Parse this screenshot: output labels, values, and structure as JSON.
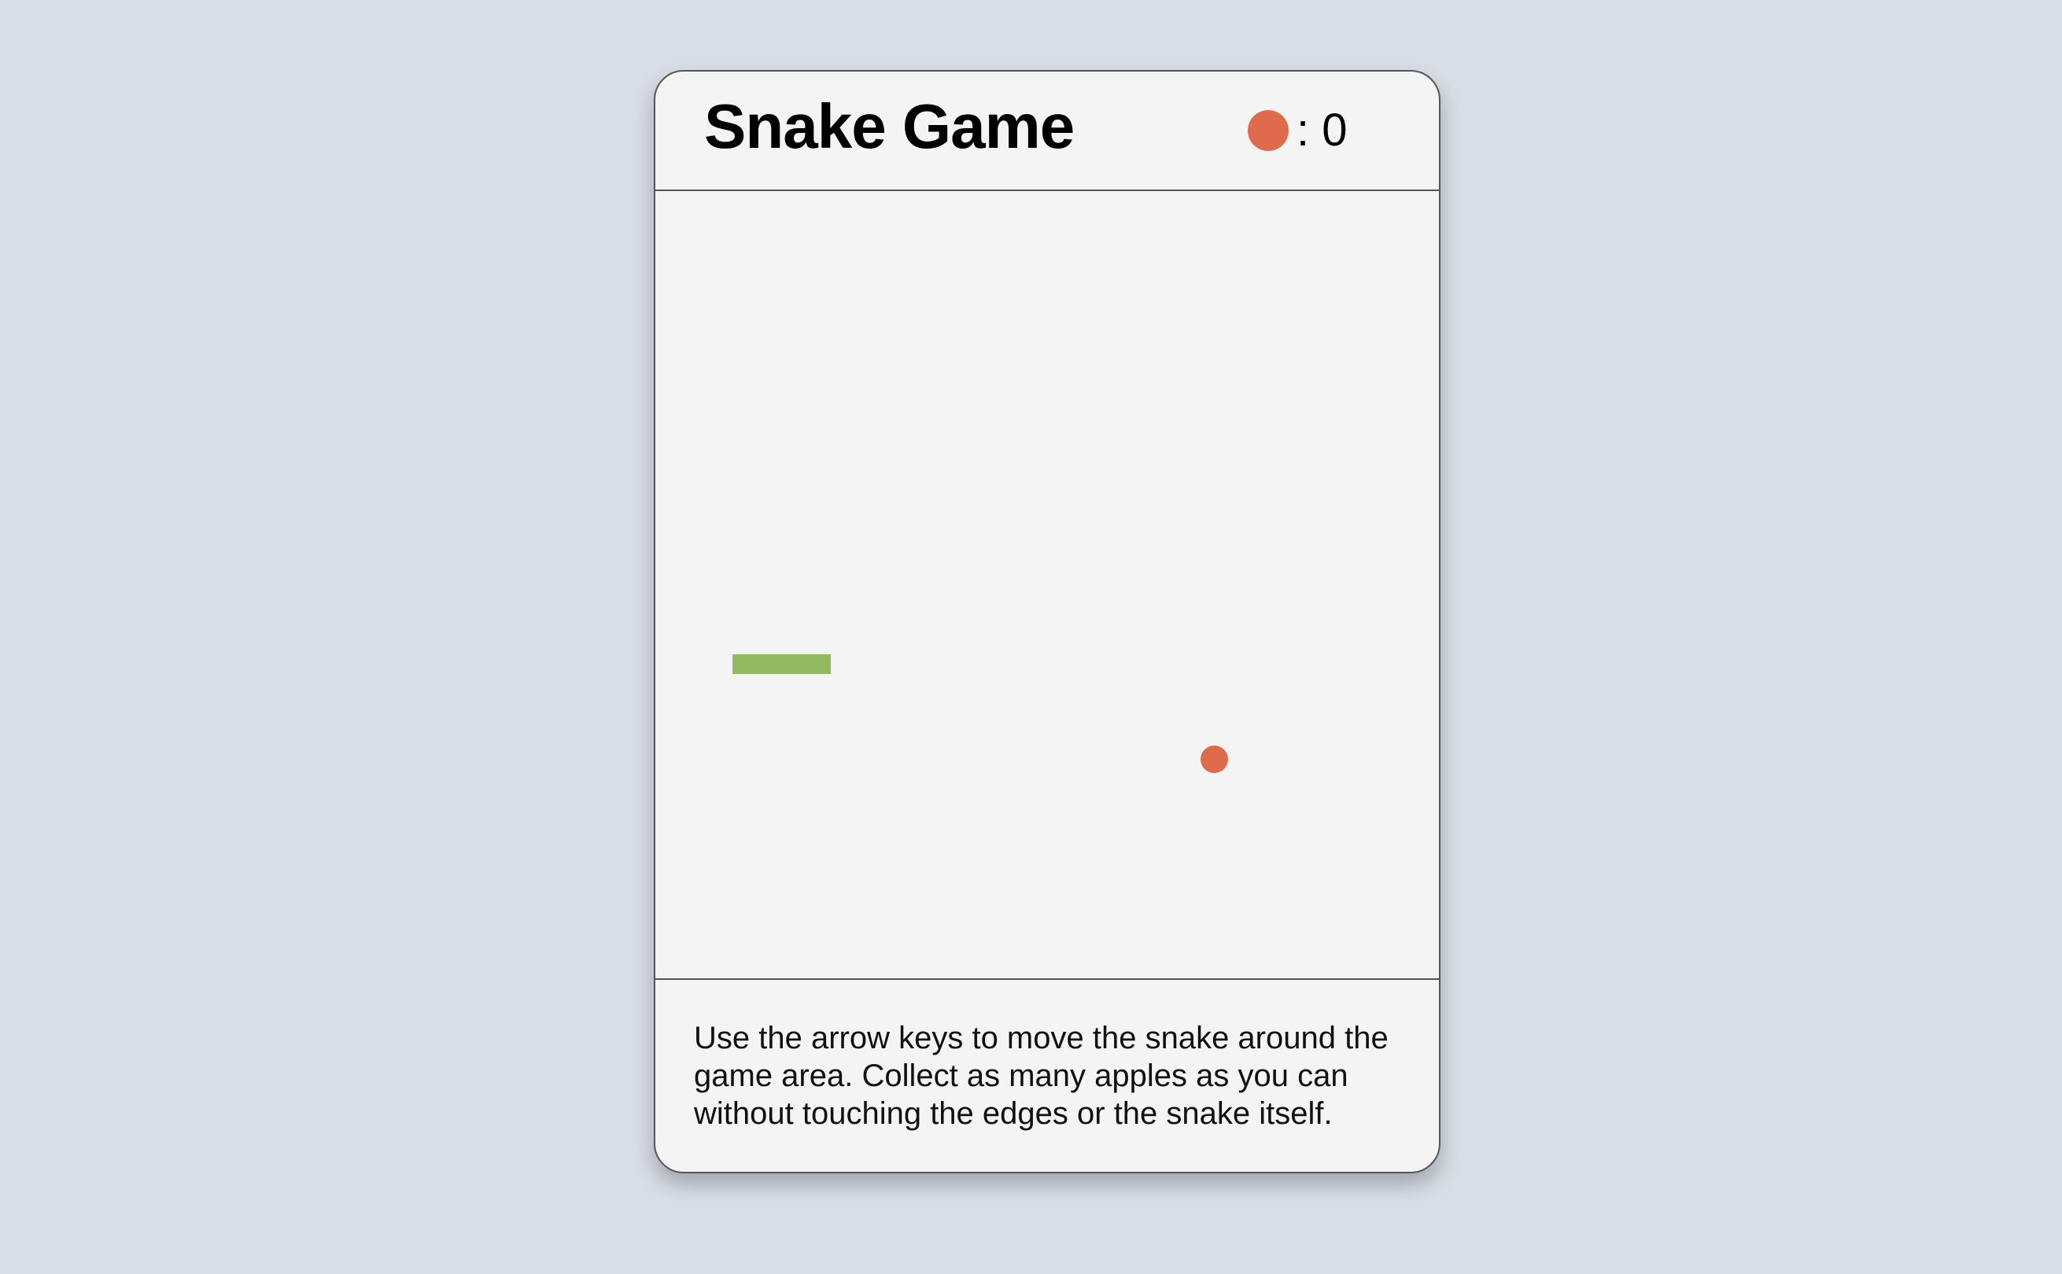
{
  "game": {
    "title": "Snake Game",
    "score_icon": "apple-icon",
    "score_separator": ":",
    "score": "0",
    "instructions": "Use the arrow keys to move the snake around the game area. Collect as many apples as you can without touching the edges or the snake itself.",
    "colors": {
      "snake": "#92b862",
      "apple": "#e06a4c",
      "board": "#f4f4f4",
      "page_background": "#d8dde6"
    }
  }
}
